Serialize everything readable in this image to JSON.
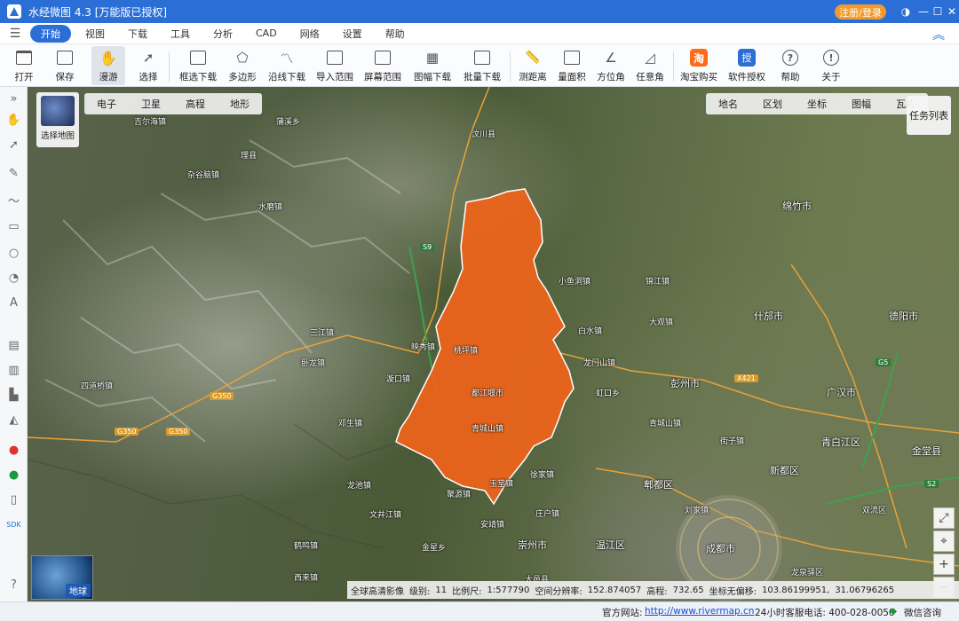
{
  "window": {
    "title": "水经微图 4.3 [万能版已授权]",
    "login_button": "注册/登录",
    "controls": {
      "skin": "◑",
      "menu": "≡",
      "minimize": "—",
      "maximize": "☐",
      "close": "✕"
    }
  },
  "menu": {
    "items": [
      "开始",
      "视图",
      "下载",
      "工具",
      "分析",
      "CAD",
      "网络",
      "设置",
      "帮助"
    ],
    "active": "开始"
  },
  "toolbar": {
    "tools": [
      "打开",
      "保存",
      "漫游",
      "选择",
      "框选下载",
      "多边形",
      "沿线下载",
      "导入范围",
      "屏幕范围",
      "图幅下载",
      "批量下载",
      "测距离",
      "量面积",
      "方位角",
      "任意角",
      "淘宝购买",
      "软件授权",
      "帮助",
      "关于"
    ],
    "active": "漫游",
    "icons": {
      "taobao": "淘",
      "license": "授"
    }
  },
  "map": {
    "map_select_label": "选择地图",
    "left_tabs": [
      "电子",
      "卫星",
      "高程",
      "地形"
    ],
    "right_tabs": [
      "地名",
      "区划",
      "坐标",
      "图幅",
      "瓦片"
    ],
    "task_list": "任务列表",
    "globe_label": "地球",
    "region_color": "#f0641a",
    "places": {
      "jierhai": "吉尔海镇",
      "puxi": "蒲溪乡",
      "lixian": "理县",
      "zagunao": "杂谷脑镇",
      "shuimo": "水磨镇",
      "wenchuan": "汶川县",
      "sanjiang": "三江镇",
      "yingxiu": "映秀镇",
      "dengsheng": "邓生镇",
      "wolong": "卧龙镇",
      "sidaoqiao": "四道桥镇",
      "xuanko": "漩口镇",
      "huaxi": "桃坪镇",
      "cheng": "玉堂镇",
      "juyuan": "聚源镇",
      "daguan": "大观镇",
      "dujiangyan": "都江堰市",
      "qingchengshan": "青城山镇",
      "xujia": "徐家镇",
      "longchi": "龙池镇",
      "hongkou": "虹口乡",
      "xiaoyudong": "小鱼洞镇",
      "longmenshan": "龙门山镇",
      "baishui": "白水镇",
      "jinjiang": "锦江镇",
      "mianzhu": "绵竹市",
      "shifang": "什邡市",
      "deyang": "德阳市",
      "pengzhou": "彭州市",
      "guanghan": "广汉市",
      "xindu": "新都区",
      "qingbaijiang": "青白江区",
      "pixian": "郫都区",
      "wenjiang": "温江区",
      "chongzhou": "崇州市",
      "dayi": "大邑县",
      "chengdu": "成都市",
      "jintang": "金堂县",
      "longquan": "龙泉驿区",
      "shuangliu": "双流区",
      "anjing": "安靖镇",
      "zhuanghuan": "庄户镇",
      "liujie": "刘家镇",
      "heming": "鹤鸣镇",
      "xilai": "西来镇",
      "jieyang": "街子镇",
      "wenping": "文井江镇",
      "jinjiaoshan": "金星乡",
      "road_g350a": "G350",
      "road_g350b": "G350",
      "road_g350c": "G350",
      "hwy_s9": "S9",
      "hwy_g5": "G5",
      "hwy_s2": "S2",
      "road_x421": "X421"
    }
  },
  "status": {
    "source": "全球高清影像",
    "level_label": "级别:",
    "level_value": "11",
    "scale_label": "比例尺:",
    "scale_value": "1:577790",
    "res_label": "空间分辨率:",
    "res_value": "152.874057",
    "elev_label": "高程:",
    "elev_value": "732.65",
    "offset_label": "坐标无偏移:",
    "lon_value": "103.86199951,",
    "lat_value": "31.06796265"
  },
  "footer": {
    "site_label": "官方网站:",
    "site_url": "http://www.rivermap.cn",
    "hotline": "24小时客服电话: 400-028-0050",
    "wechat": "微信咨询"
  }
}
